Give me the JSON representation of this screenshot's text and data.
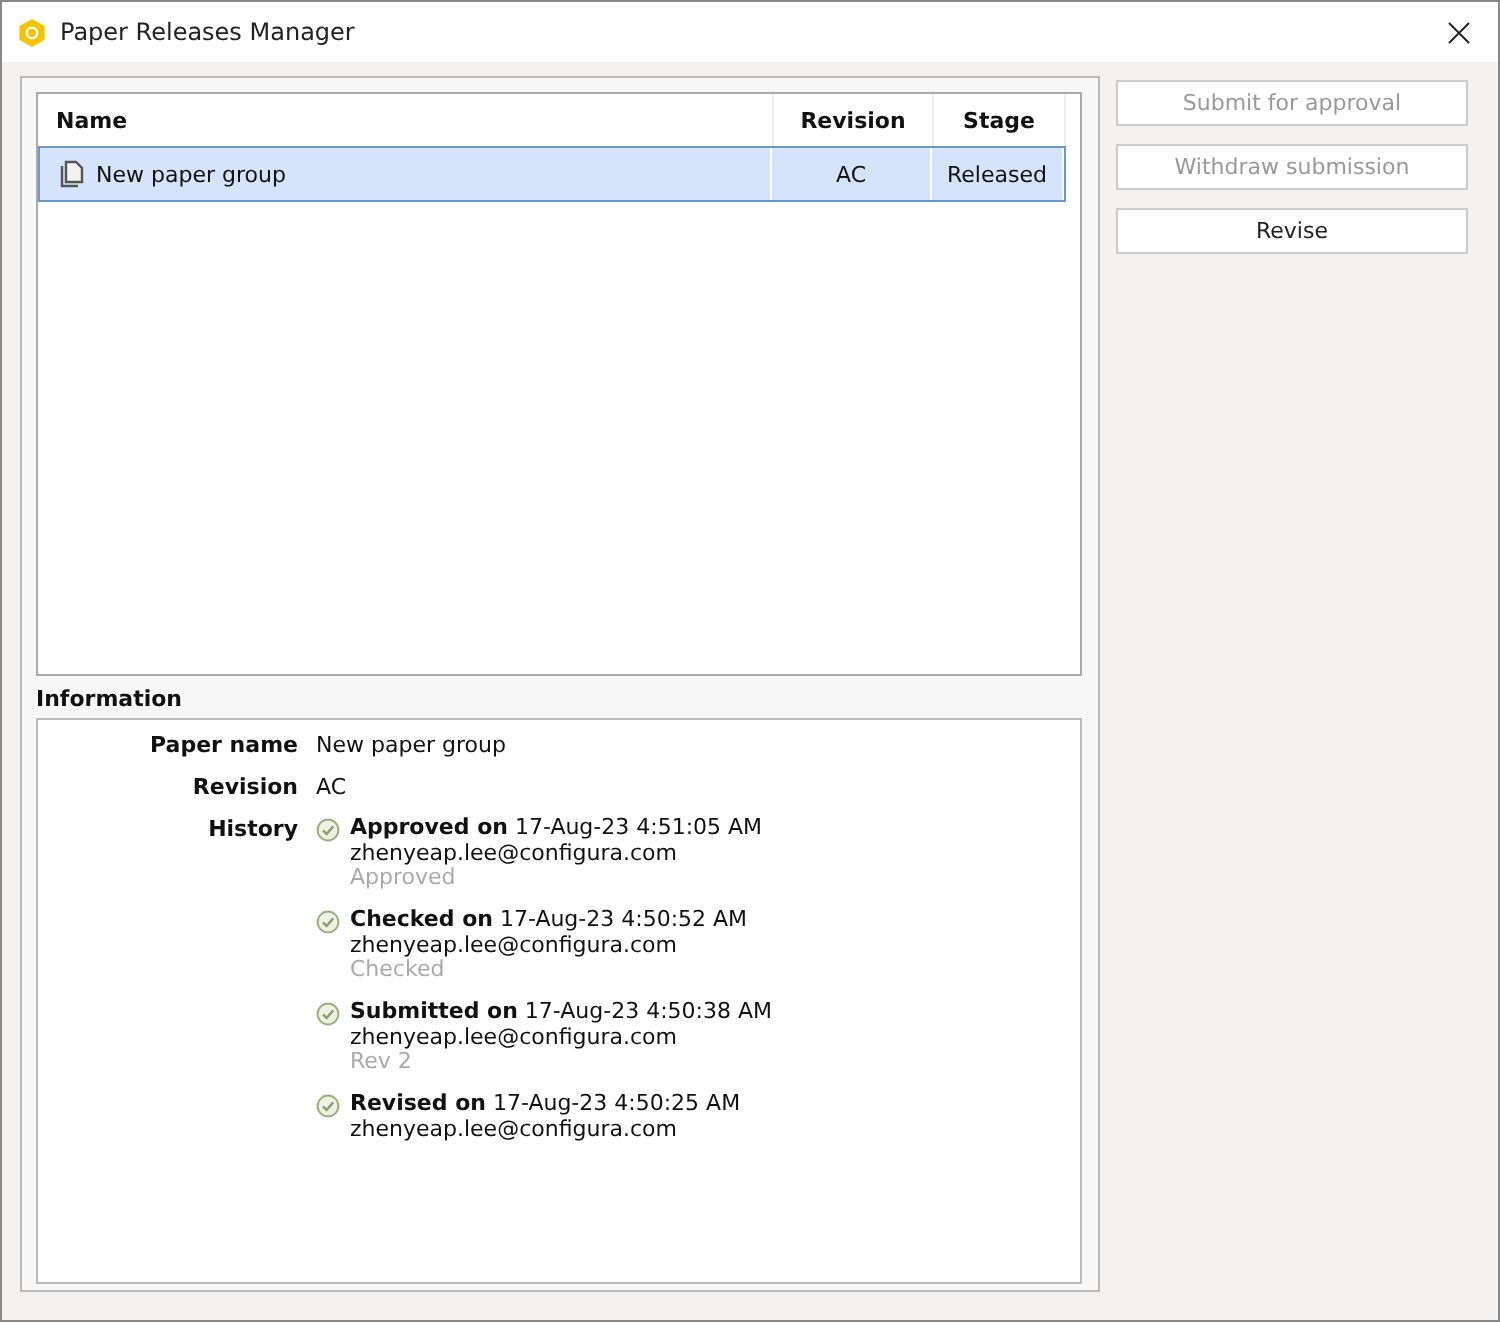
{
  "window": {
    "title": "Paper Releases Manager"
  },
  "table": {
    "columns": [
      "Name",
      "Revision",
      "Stage"
    ],
    "rows": [
      {
        "name": "New paper group",
        "revision": "AC",
        "stage": "Released",
        "selected": true
      }
    ]
  },
  "information": {
    "heading": "Information",
    "fields": [
      {
        "label": "Paper name",
        "value": "New paper group"
      },
      {
        "label": "Revision",
        "value": "AC"
      }
    ],
    "history_label": "History",
    "history": [
      {
        "title": "**Approved on** 17-Aug-23 4:51:05 AM",
        "user": "zhenyeap.lee@configura.com",
        "note": "Approved"
      },
      {
        "title": "**Checked on** 17-Aug-23 4:50:52 AM",
        "user": "zhenyeap.lee@configura.com",
        "note": "Checked"
      },
      {
        "title": "**Submitted on** 17-Aug-23 4:50:38 AM",
        "user": "zhenyeap.lee@configura.com",
        "note": "Rev 2"
      },
      {
        "title": "**Revised on** 17-Aug-23 4:50:25 AM",
        "user": "zhenyeap.lee@configura.com"
      }
    ]
  },
  "buttons": [
    {
      "label": "Submit for approval",
      "disabled": true
    },
    {
      "label": "Withdraw submission",
      "disabled": true
    },
    {
      "label": "Revise",
      "disabled": false
    }
  ]
}
